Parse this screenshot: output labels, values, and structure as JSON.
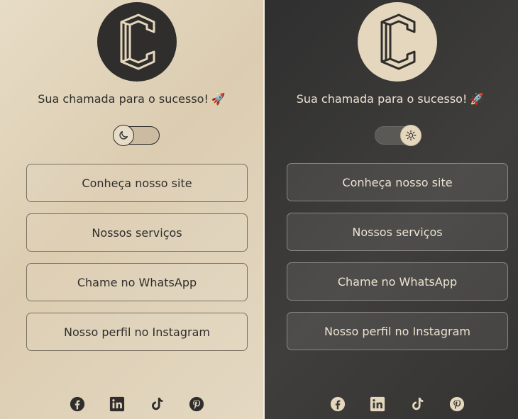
{
  "tagline": "Sua chamada para o sucesso!",
  "tagline_emoji": "🚀",
  "buttons": {
    "site": "Conheça nosso site",
    "services": "Nossos serviços",
    "whatsapp": "Chame no WhatsApp",
    "instagram": "Nosso perfil no Instagram"
  },
  "theme_toggle": {
    "light_icon": "moon-icon",
    "dark_icon": "sun-icon"
  },
  "social_icons": [
    "facebook-icon",
    "linkedin-icon",
    "tiktok-icon",
    "pinterest-icon"
  ],
  "colors": {
    "light_bg": "#e2d6be",
    "dark_bg": "#3a3938",
    "dark_text": "#2f2e2c",
    "light_text": "#ede4d2"
  }
}
